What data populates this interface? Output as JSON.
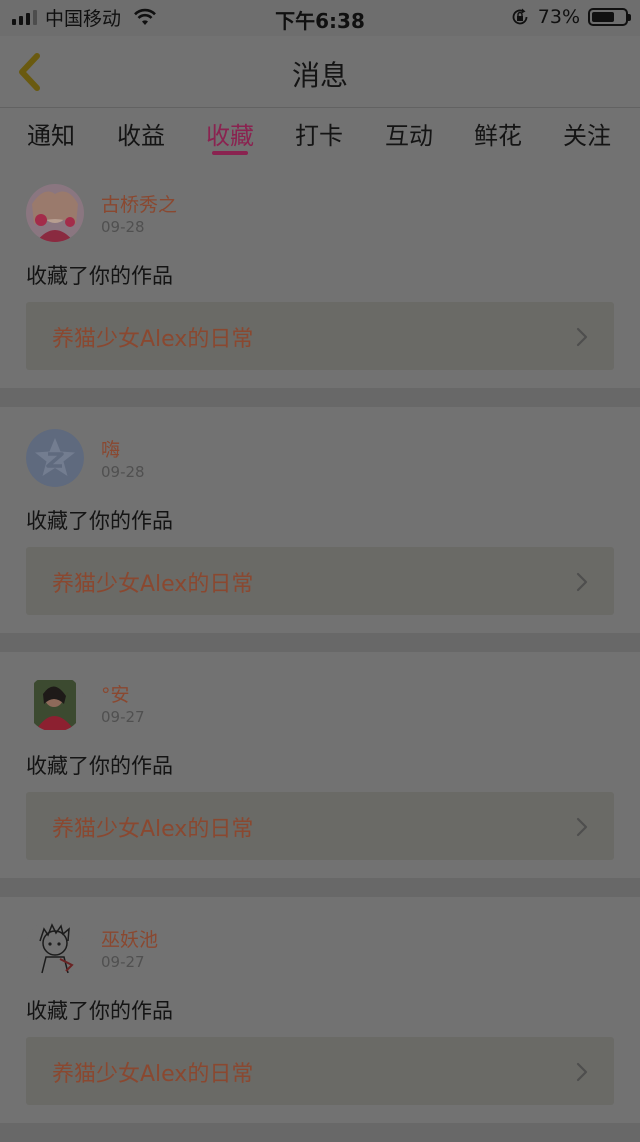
{
  "status_bar": {
    "carrier": "中国移动",
    "time": "下午6:38",
    "battery_percent": "73%",
    "battery_level": 0.73,
    "icons": [
      "signal-icon",
      "wifi-icon",
      "rotation-lock-icon",
      "battery-icon"
    ]
  },
  "header": {
    "title": "消息",
    "back_icon": "chevron-left-icon"
  },
  "tabs": [
    {
      "label": "通知"
    },
    {
      "label": "收益"
    },
    {
      "label": "收藏"
    },
    {
      "label": "打卡"
    },
    {
      "label": "互动"
    },
    {
      "label": "鲜花"
    },
    {
      "label": "关注"
    }
  ],
  "active_tab": "收藏",
  "messages": [
    {
      "user": "古桥秀之",
      "date": "09-28",
      "action": "收藏了你的作品",
      "work": "养猫少女Alex的日常"
    },
    {
      "user": "嗨",
      "date": "09-28",
      "action": "收藏了你的作品",
      "work": "养猫少女Alex的日常"
    },
    {
      "user": "°安",
      "date": "09-27",
      "action": "收藏了你的作品",
      "work": "养猫少女Alex的日常"
    },
    {
      "user": "巫妖池",
      "date": "09-27",
      "action": "收藏了你的作品",
      "work": "养猫少女Alex的日常"
    }
  ],
  "colors": {
    "accent": "#e53a80",
    "username": "#e9764a",
    "overlay": "rgba(0,0,0,0.55)"
  }
}
